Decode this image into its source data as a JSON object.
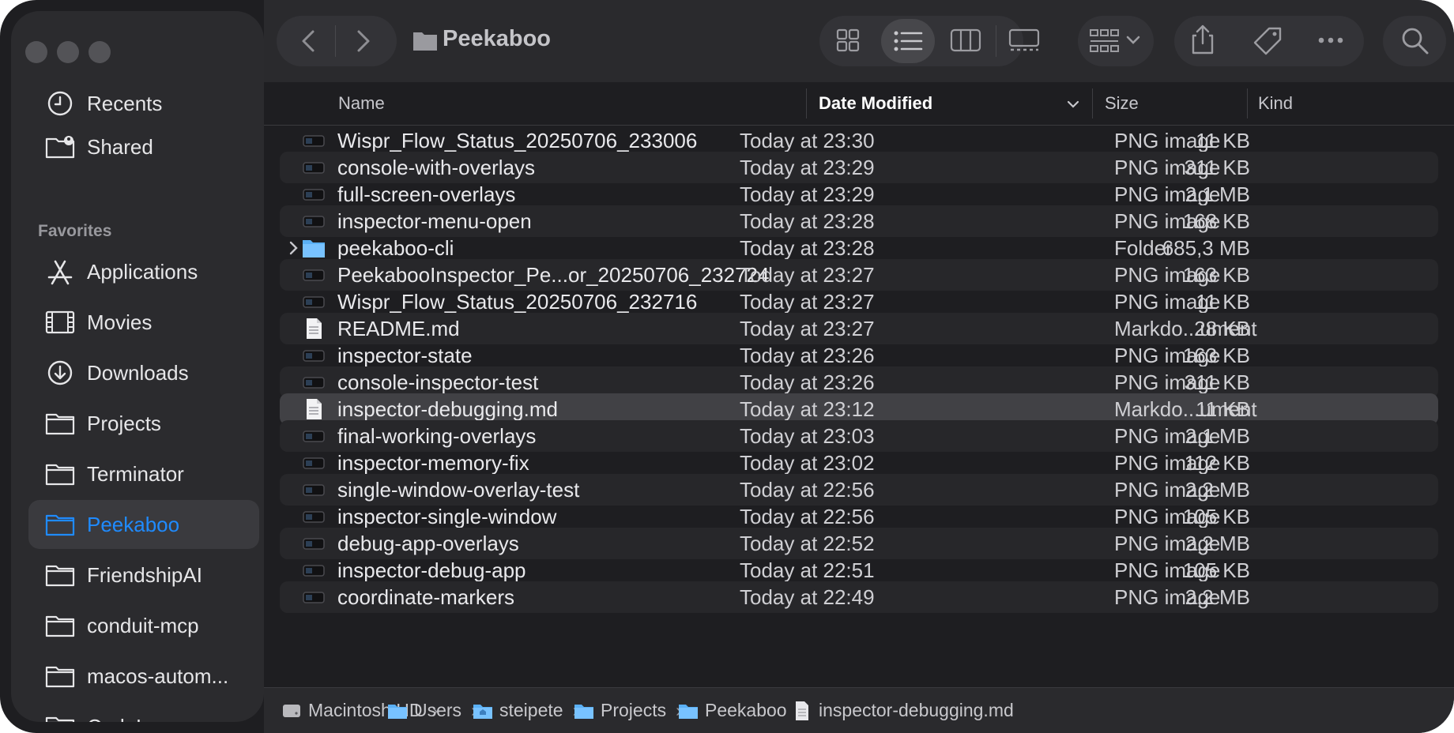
{
  "window": {
    "title": "Peekaboo"
  },
  "sidebar": {
    "top_items": [
      {
        "label": "Recents",
        "icon": "clock-icon"
      },
      {
        "label": "Shared",
        "icon": "shared-folder-icon"
      }
    ],
    "favorites_header": "Favorites",
    "favorites": [
      {
        "label": "Applications",
        "icon": "applications-icon"
      },
      {
        "label": "Movies",
        "icon": "film-icon"
      },
      {
        "label": "Downloads",
        "icon": "download-icon"
      },
      {
        "label": "Projects",
        "icon": "folder-icon"
      },
      {
        "label": "Terminator",
        "icon": "folder-icon"
      },
      {
        "label": "Peekaboo",
        "icon": "folder-icon",
        "selected": true
      },
      {
        "label": "FriendshipAI",
        "icon": "folder-icon"
      },
      {
        "label": "conduit-mcp",
        "icon": "folder-icon"
      },
      {
        "label": "macos-autom...",
        "icon": "folder-icon"
      },
      {
        "label": "CodeLooper",
        "icon": "folder-icon"
      }
    ]
  },
  "columns": {
    "name": "Name",
    "date": "Date Modified",
    "size": "Size",
    "kind": "Kind"
  },
  "files": [
    {
      "name": "Wispr_Flow_Status_20250706_233006",
      "date": "Today at 23:30",
      "size": "11 KB",
      "kind": "PNG image",
      "icon": "png-thumb-icon"
    },
    {
      "name": "console-with-overlays",
      "date": "Today at 23:29",
      "size": "311 KB",
      "kind": "PNG image",
      "icon": "png-thumb-icon"
    },
    {
      "name": "full-screen-overlays",
      "date": "Today at 23:29",
      "size": "2,1 MB",
      "kind": "PNG image",
      "icon": "png-thumb-icon"
    },
    {
      "name": "inspector-menu-open",
      "date": "Today at 23:28",
      "size": "168 KB",
      "kind": "PNG image",
      "icon": "png-thumb-icon"
    },
    {
      "name": "peekaboo-cli",
      "date": "Today at 23:28",
      "size": "685,3 MB",
      "kind": "Folder",
      "icon": "folder-icon",
      "folder": true
    },
    {
      "name": "PeekabooInspector_Pe...or_20250706_232724",
      "date": "Today at 23:27",
      "size": "163 KB",
      "kind": "PNG image",
      "icon": "png-thumb-icon"
    },
    {
      "name": "Wispr_Flow_Status_20250706_232716",
      "date": "Today at 23:27",
      "size": "11 KB",
      "kind": "PNG image",
      "icon": "png-thumb-icon"
    },
    {
      "name": "README.md",
      "date": "Today at 23:27",
      "size": "28 KB",
      "kind": "Markdo...ument",
      "icon": "document-icon"
    },
    {
      "name": "inspector-state",
      "date": "Today at 23:26",
      "size": "163 KB",
      "kind": "PNG image",
      "icon": "png-thumb-icon"
    },
    {
      "name": "console-inspector-test",
      "date": "Today at 23:26",
      "size": "311 KB",
      "kind": "PNG image",
      "icon": "png-thumb-icon"
    },
    {
      "name": "inspector-debugging.md",
      "date": "Today at 23:12",
      "size": "11 KB",
      "kind": "Markdo...ument",
      "icon": "document-icon",
      "selected": true
    },
    {
      "name": "final-working-overlays",
      "date": "Today at 23:03",
      "size": "2,1 MB",
      "kind": "PNG image",
      "icon": "png-thumb-icon"
    },
    {
      "name": "inspector-memory-fix",
      "date": "Today at 23:02",
      "size": "112 KB",
      "kind": "PNG image",
      "icon": "png-thumb-icon"
    },
    {
      "name": "single-window-overlay-test",
      "date": "Today at 22:56",
      "size": "2,2 MB",
      "kind": "PNG image",
      "icon": "png-thumb-icon"
    },
    {
      "name": "inspector-single-window",
      "date": "Today at 22:56",
      "size": "105 KB",
      "kind": "PNG image",
      "icon": "png-thumb-icon"
    },
    {
      "name": "debug-app-overlays",
      "date": "Today at 22:52",
      "size": "2,2 MB",
      "kind": "PNG image",
      "icon": "png-thumb-icon"
    },
    {
      "name": "inspector-debug-app",
      "date": "Today at 22:51",
      "size": "105 KB",
      "kind": "PNG image",
      "icon": "png-thumb-icon"
    },
    {
      "name": "coordinate-markers",
      "date": "Today at 22:49",
      "size": "2,2 MB",
      "kind": "PNG image",
      "icon": "png-thumb-icon"
    }
  ],
  "pathbar": [
    {
      "label": "Macintosh HD",
      "icon": "hard-drive-icon"
    },
    {
      "label": "Users",
      "icon": "folder-icon"
    },
    {
      "label": "steipete",
      "icon": "home-folder-icon"
    },
    {
      "label": "Projects",
      "icon": "folder-icon"
    },
    {
      "label": "Peekaboo",
      "icon": "folder-icon"
    },
    {
      "label": "inspector-debugging.md",
      "icon": "document-icon"
    }
  ],
  "colors": {
    "accent": "#1f8bff",
    "folder": "#5ab0f5"
  }
}
